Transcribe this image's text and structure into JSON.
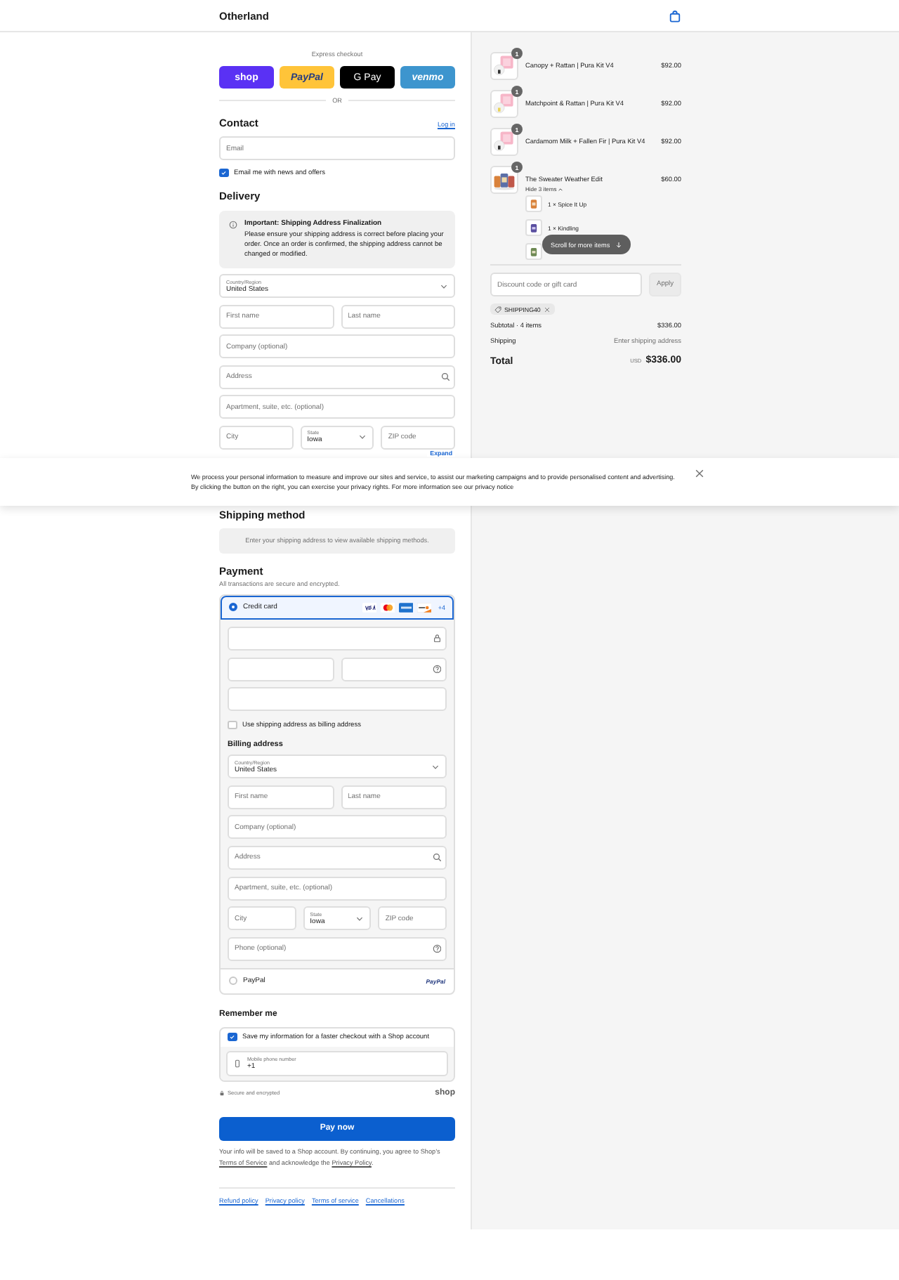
{
  "header": {
    "brand": "Otherland"
  },
  "express_checkout": {
    "title": "Express checkout",
    "divider": "OR",
    "buttons": [
      {
        "kind": "shop",
        "label": "shop"
      },
      {
        "kind": "paypal",
        "label": "PayPal"
      },
      {
        "kind": "gpay",
        "label": "G Pay"
      },
      {
        "kind": "venmo",
        "label": "venmo"
      }
    ]
  },
  "contact": {
    "title": "Contact",
    "login": "Log in",
    "email": {
      "placeholder": "Email"
    },
    "newsletter": {
      "label": "Email me with news and offers",
      "checked": true
    }
  },
  "delivery": {
    "title": "Delivery",
    "notice": {
      "title": "Important: Shipping Address Finalization",
      "body": "Please ensure your shipping address is correct before placing your order. Once an order is confirmed, the shipping address cannot be changed or modified."
    },
    "rows": [
      [
        {
          "kind": "select",
          "label": "Country/Region",
          "value": "United States"
        }
      ],
      [
        {
          "kind": "text",
          "placeholder": "First name"
        },
        {
          "kind": "text",
          "placeholder": "Last name"
        }
      ],
      [
        {
          "kind": "text",
          "placeholder": "Company (optional)"
        }
      ],
      [
        {
          "kind": "search",
          "placeholder": "Address"
        }
      ],
      [
        {
          "kind": "text",
          "placeholder": "Apartment, suite, etc. (optional)"
        }
      ],
      [
        {
          "kind": "text",
          "placeholder": "City"
        },
        {
          "kind": "select",
          "label": "State",
          "value": "Iowa"
        },
        {
          "kind": "text",
          "placeholder": "ZIP code"
        }
      ]
    ],
    "expand": "Expand"
  },
  "cookie_banner": {
    "text": "We process your personal information to measure and improve our sites and service, to assist our marketing campaigns and to provide personalised content and advertising. By clicking the button on the right, you can exercise your privacy rights. For more information see our privacy notice"
  },
  "shipping_method": {
    "title": "Shipping method",
    "message": "Enter your shipping address to view available shipping methods."
  },
  "payment": {
    "title": "Payment",
    "subtitle": "All transactions are secure and encrypted.",
    "methods": [
      {
        "kind": "card",
        "label": "Credit card",
        "selected": true,
        "more": "+4"
      },
      {
        "kind": "paypal",
        "label": "PayPal",
        "selected": false,
        "logo": "PayPal"
      }
    ],
    "card_rows": [
      [
        {
          "kind": "lock"
        }
      ],
      [
        {
          "kind": "text"
        },
        {
          "kind": "help"
        }
      ],
      [
        {
          "kind": "text"
        }
      ]
    ],
    "billing_same": {
      "label": "Use shipping address as billing address",
      "checked": false
    },
    "billing": {
      "title": "Billing address",
      "rows": [
        [
          {
            "kind": "select",
            "label": "Country/Region",
            "value": "United States"
          }
        ],
        [
          {
            "kind": "text",
            "placeholder": "First name"
          },
          {
            "kind": "text",
            "placeholder": "Last name"
          }
        ],
        [
          {
            "kind": "text",
            "placeholder": "Company (optional)"
          }
        ],
        [
          {
            "kind": "search",
            "placeholder": "Address"
          }
        ],
        [
          {
            "kind": "text",
            "placeholder": "Apartment, suite, etc. (optional)"
          }
        ],
        [
          {
            "kind": "text",
            "placeholder": "City"
          },
          {
            "kind": "select",
            "label": "State",
            "value": "Iowa"
          },
          {
            "kind": "text",
            "placeholder": "ZIP code"
          }
        ],
        [
          {
            "kind": "help",
            "placeholder": "Phone (optional)"
          }
        ]
      ]
    }
  },
  "remember": {
    "title": "Remember me",
    "save": {
      "label": "Save my information for a faster checkout with a Shop account",
      "checked": true
    },
    "phone": {
      "label": "Mobile phone number",
      "value": "+1"
    },
    "secure": "Secure and encrypted",
    "shop_logo": "shop"
  },
  "pay_button": "Pay now",
  "legal": [
    {
      "kind": "text",
      "text": "Your info will be saved to a Shop account. By continuing, you agree to Shop’s "
    },
    {
      "kind": "link",
      "text": "Terms of Service"
    },
    {
      "kind": "text",
      "text": " and acknowledge the "
    },
    {
      "kind": "link",
      "text": "Privacy Policy"
    },
    {
      "kind": "text",
      "text": "."
    }
  ],
  "footer_links": [
    "Refund policy",
    "Privacy policy",
    "Terms of service",
    "Cancellations"
  ],
  "cart": {
    "items": [
      {
        "name": "Canopy + Rattan | Pura Kit V4",
        "price": "$92.00",
        "quantity": "1"
      },
      {
        "name": "Matchpoint & Rattan | Pura Kit V4",
        "price": "$92.00",
        "quantity": "1"
      },
      {
        "name": "Cardamom Milk + Fallen Fir | Pura Kit V4",
        "price": "$92.00",
        "quantity": "1"
      },
      {
        "name": "The Sweater Weather Edit",
        "price": "$60.00",
        "quantity": "1",
        "toggle": "Hide 3 items",
        "subitems": [
          {
            "label": "1 × Spice It Up"
          },
          {
            "label": "1 × Kindling"
          }
        ],
        "covered_subitem": true
      }
    ],
    "scroll_hint": "Scroll for more items",
    "discount": {
      "placeholder": "Discount code or gift card",
      "button": "Apply",
      "applied": "SHIPPING40"
    },
    "summary": {
      "subtotal_label": "Subtotal · 4 items",
      "subtotal": "$336.00",
      "shipping_label": "Shipping",
      "shipping": "Enter shipping address",
      "total_label": "Total",
      "currency": "USD",
      "total": "$336.00"
    }
  }
}
